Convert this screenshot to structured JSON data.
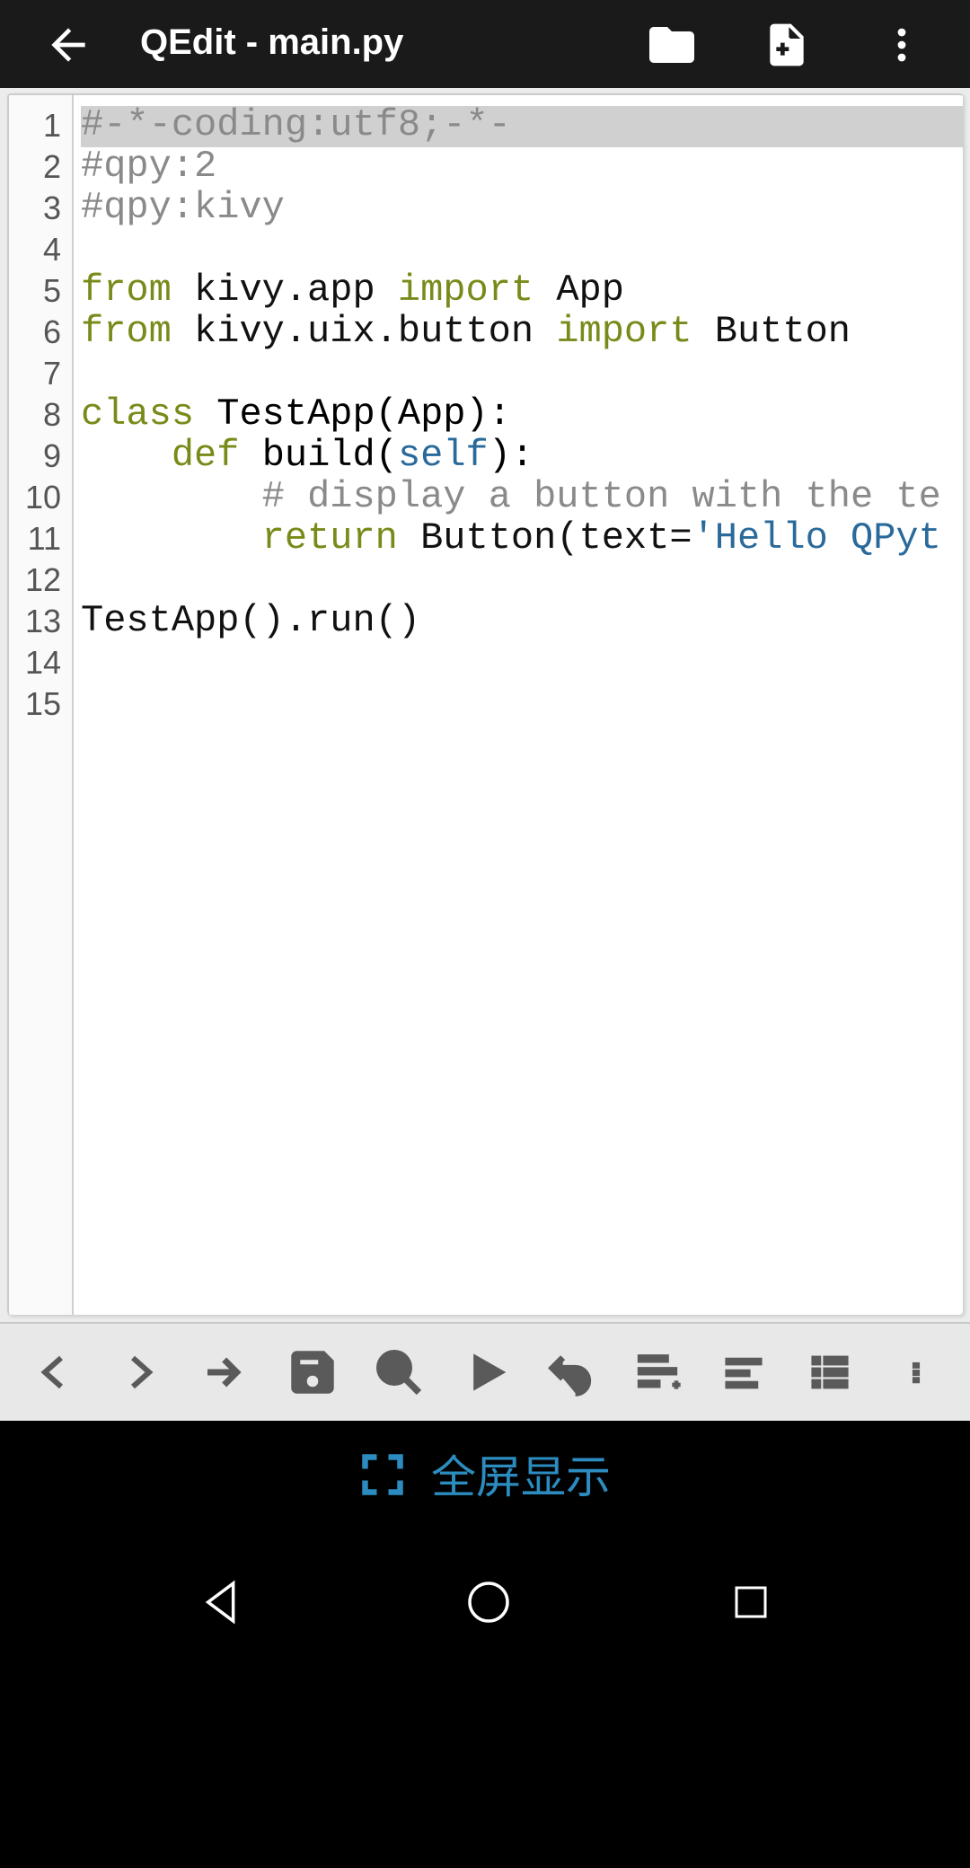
{
  "header": {
    "title": "QEdit - main.py"
  },
  "code": {
    "lines": [
      {
        "n": "1",
        "tokens": [
          {
            "t": "#-*-coding:utf8;-*-",
            "c": "c-comment",
            "hl": true
          }
        ]
      },
      {
        "n": "2",
        "tokens": [
          {
            "t": "#qpy:2",
            "c": "c-comment"
          }
        ]
      },
      {
        "n": "3",
        "tokens": [
          {
            "t": "#qpy:kivy",
            "c": "c-comment"
          }
        ]
      },
      {
        "n": "4",
        "tokens": []
      },
      {
        "n": "5",
        "tokens": [
          {
            "t": "from ",
            "c": "c-key"
          },
          {
            "t": "kivy.app "
          },
          {
            "t": "import ",
            "c": "c-key"
          },
          {
            "t": "App"
          }
        ]
      },
      {
        "n": "6",
        "tokens": [
          {
            "t": "from ",
            "c": "c-key"
          },
          {
            "t": "kivy.uix.button "
          },
          {
            "t": "import ",
            "c": "c-key"
          },
          {
            "t": "Button"
          }
        ]
      },
      {
        "n": "7",
        "tokens": []
      },
      {
        "n": "8",
        "tokens": [
          {
            "t": "class ",
            "c": "c-key"
          },
          {
            "t": "TestApp(App):",
            "c": "c-def"
          }
        ]
      },
      {
        "n": "9",
        "tokens": [
          {
            "t": "    "
          },
          {
            "t": "def ",
            "c": "c-key"
          },
          {
            "t": "build(",
            "c": "c-def"
          },
          {
            "t": "self",
            "c": "c-self"
          },
          {
            "t": "):",
            "c": "c-def"
          }
        ]
      },
      {
        "n": "10",
        "tokens": [
          {
            "t": "        "
          },
          {
            "t": "# display a button with the te",
            "c": "c-comment"
          }
        ]
      },
      {
        "n": "11",
        "tokens": [
          {
            "t": "        "
          },
          {
            "t": "return ",
            "c": "c-key"
          },
          {
            "t": "Button(text="
          },
          {
            "t": "'Hello QPyt",
            "c": "c-str"
          }
        ]
      },
      {
        "n": "12",
        "tokens": []
      },
      {
        "n": "13",
        "tokens": [
          {
            "t": "TestApp().run()"
          }
        ]
      },
      {
        "n": "14",
        "tokens": []
      },
      {
        "n": "15",
        "tokens": []
      }
    ]
  },
  "fullscreen": {
    "label": "全屏显示"
  }
}
